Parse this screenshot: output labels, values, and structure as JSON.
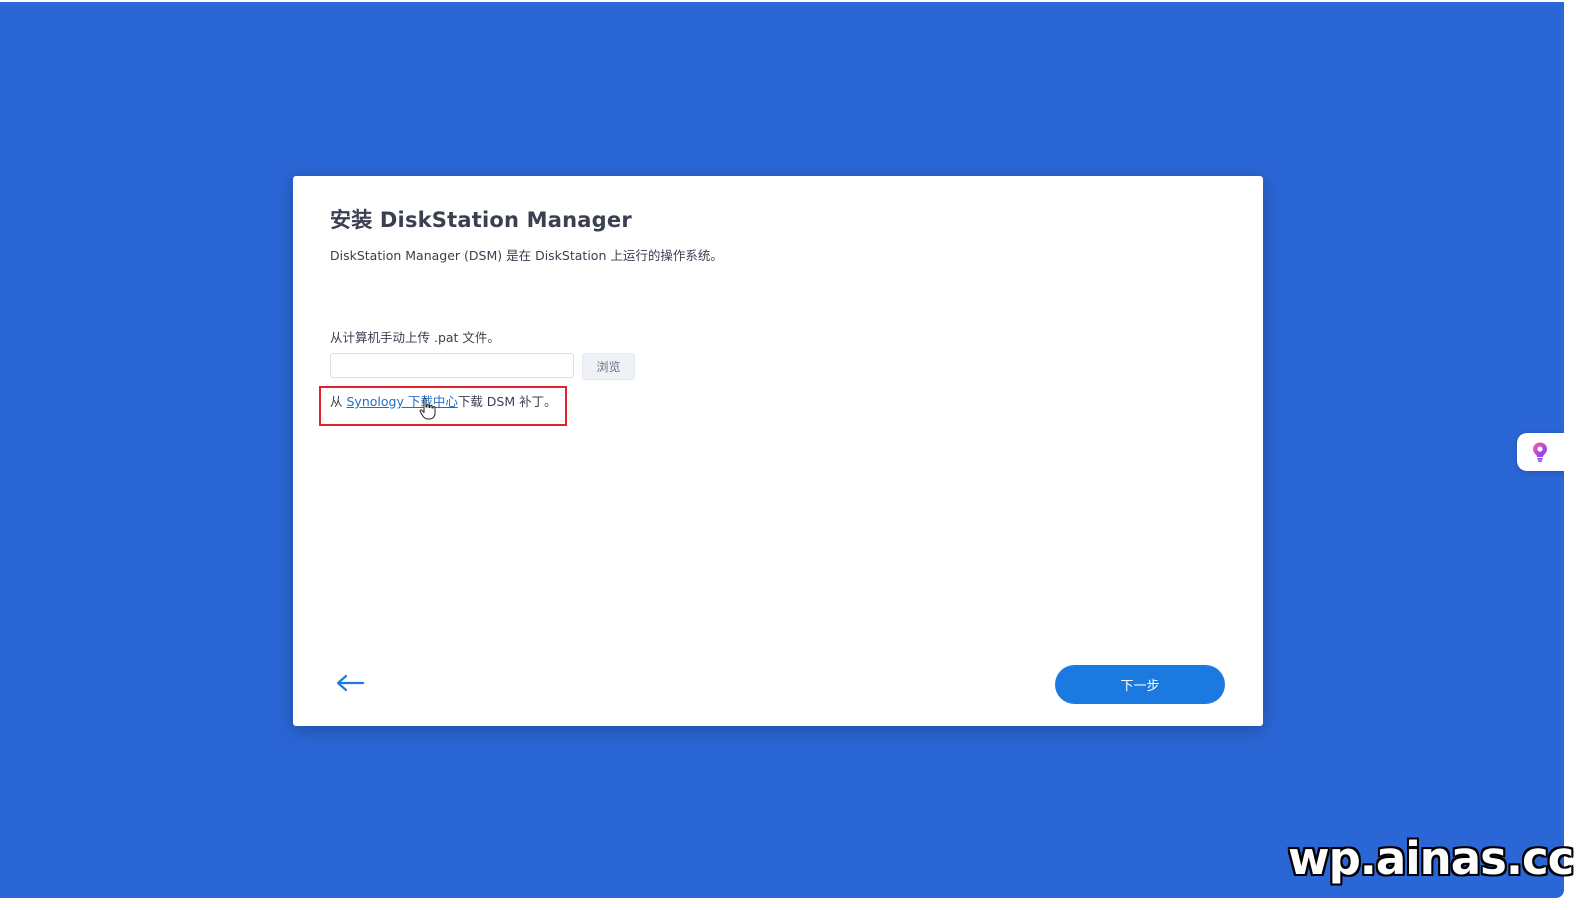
{
  "dialog": {
    "title": "安装 DiskStation Manager",
    "subtitle": "DiskStation Manager (DSM) 是在 DiskStation 上运行的操作系统。",
    "upload_label": "从计算机手动上传 .pat 文件。",
    "file_input_value": "",
    "browse_label": "浏览",
    "download_prefix": "从 ",
    "download_link": "Synology 下载中心",
    "download_suffix": "下载 DSM 补丁。",
    "next_label": "下一步"
  },
  "watermark": "wp.ainas.cc",
  "colors": {
    "background": "#2b66d6",
    "accent": "#1a7ae0",
    "link": "#1f6fc5",
    "highlight": "#e0202a"
  },
  "icons": {
    "back": "arrow-left-icon",
    "widget": "lightbulb-icon",
    "cursor": "hand-pointer-icon"
  }
}
